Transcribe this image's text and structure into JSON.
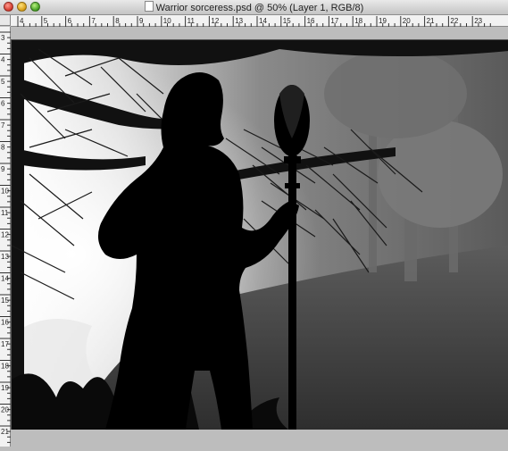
{
  "window": {
    "title": "Warrior sorceress.psd @ 50% (Layer 1, RGB/8)"
  },
  "ruler_top_labels": [
    "4",
    "5",
    "6",
    "7",
    "8",
    "9",
    "10",
    "11",
    "12",
    "13",
    "14",
    "15",
    "16",
    "17",
    "18",
    "19",
    "20",
    "21",
    "22",
    "23"
  ],
  "ruler_left_labels": [
    "3",
    "4",
    "5",
    "6",
    "7",
    "8",
    "9",
    "10",
    "11",
    "12",
    "13",
    "14",
    "15",
    "16",
    "17",
    "18",
    "19",
    "20",
    "21"
  ],
  "colors": {
    "canvas_bg": "#bdbdbd",
    "silhouette": "#000000",
    "fog_light": "#ffffff",
    "fog_dark": "#3a3a3a"
  }
}
